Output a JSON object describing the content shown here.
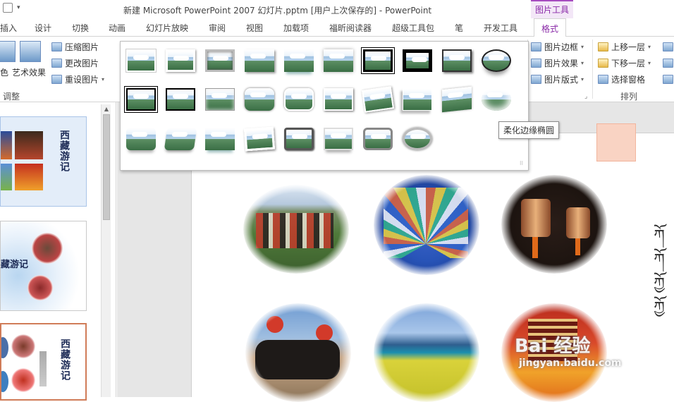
{
  "window": {
    "title": "新建 Microsoft PowerPoint 2007 幻灯片.pptm [用户上次保存的] - PowerPoint",
    "context_tab_group": "图片工具"
  },
  "tabs": [
    {
      "label": "插入"
    },
    {
      "label": "设计"
    },
    {
      "label": "切换"
    },
    {
      "label": "动画"
    },
    {
      "label": "幻灯片放映"
    },
    {
      "label": "审阅"
    },
    {
      "label": "视图"
    },
    {
      "label": "加载项"
    },
    {
      "label": "福昕阅读器"
    },
    {
      "label": "超级工具包"
    },
    {
      "label": "笔"
    },
    {
      "label": "开发工具"
    },
    {
      "label": "格式"
    }
  ],
  "ribbon": {
    "adjust": {
      "color_label": "色",
      "artistic_effects": "艺术效果",
      "compress": "压缩图片",
      "change": "更改图片",
      "reset": "重设图片",
      "group_label": "调整"
    },
    "picture_styles": {
      "border": "图片边框",
      "effects": "图片效果",
      "layout": "图片版式"
    },
    "arrange": {
      "bring_forward": "上移一层",
      "send_backward": "下移一层",
      "selection_pane": "选择窗格",
      "group_label": "排列"
    }
  },
  "gallery": {
    "rows": 3,
    "row_counts": [
      10,
      10,
      8
    ],
    "selected_tooltip": "柔化边缘椭圆"
  },
  "slides_panel": {
    "thumb1_title": "西藏游记",
    "thumb2_title": "藏游记",
    "thumb3_title": "西藏游记"
  },
  "slide": {
    "tibetan_lines": [
      "ཀོ",
      "ཀོ",
      "ཀྱོ",
      "ཀྱོ"
    ]
  },
  "watermark": {
    "text": "Bai 经验",
    "url": "jingyan.baidu.com"
  }
}
